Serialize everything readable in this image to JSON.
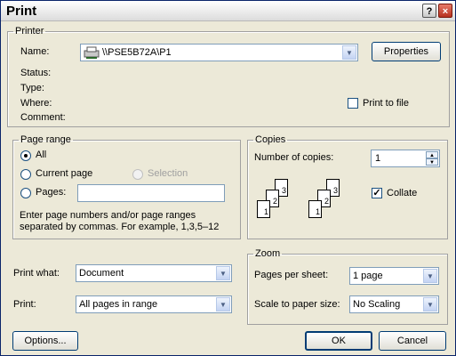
{
  "window": {
    "title": "Print",
    "help_label": "?",
    "close_label": "×"
  },
  "printer": {
    "group_label": "Printer",
    "name_label": "Name:",
    "name_value": "\\\\PSE5B72A\\P1",
    "properties_label": "Properties",
    "status_label": "Status:",
    "type_label": "Type:",
    "where_label": "Where:",
    "comment_label": "Comment:",
    "print_to_file_label": "Print to file",
    "print_to_file_checked": false
  },
  "page_range": {
    "group_label": "Page range",
    "all_label": "All",
    "current_page_label": "Current page",
    "selection_label": "Selection",
    "pages_label": "Pages:",
    "pages_value": "",
    "selected": "all",
    "hint_line1": "Enter page numbers and/or page ranges",
    "hint_line2": "separated by commas.  For example, 1,3,5–12"
  },
  "copies": {
    "group_label": "Copies",
    "number_label": "Number of copies:",
    "number_value": "1",
    "collate_label": "Collate",
    "collate_checked": true,
    "page_numbers": [
      "3",
      "2",
      "1"
    ]
  },
  "print_what": {
    "label": "Print what:",
    "value": "Document"
  },
  "print_range": {
    "label": "Print:",
    "value": "All pages in range"
  },
  "zoom": {
    "group_label": "Zoom",
    "pages_per_sheet_label": "Pages per sheet:",
    "pages_per_sheet_value": "1 page",
    "scale_label": "Scale to paper size:",
    "scale_value": "No Scaling"
  },
  "footer": {
    "options_label": "Options...",
    "ok_label": "OK",
    "cancel_label": "Cancel"
  },
  "icons": {
    "dropdown": "chevron-down-icon",
    "spin_up": "spin-up-icon",
    "spin_down": "spin-down-icon",
    "printer": "printer-icon"
  },
  "colors": {
    "frame": "#0a246a",
    "dialog_bg": "#ece9d8",
    "input_border": "#7f9db9"
  }
}
